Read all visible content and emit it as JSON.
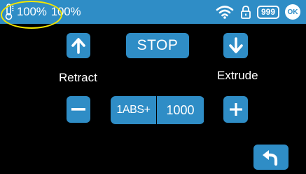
{
  "status_bar": {
    "nozzle_icon": "thermometer-icon",
    "temp_value": "100%",
    "second_value": "100%",
    "icons": [
      "wifi-icon",
      "lock-icon"
    ],
    "count_badge": "999",
    "ok_badge": "OK",
    "highlight_color": "#f2e600"
  },
  "controls": {
    "stop_label": "STOP",
    "retract_label": "Retract",
    "extrude_label": "Extrude",
    "mode_label": "1ABS+",
    "amount_label": "1000"
  },
  "icons": {
    "retract": "arrow-up-icon",
    "extrude": "arrow-down-icon",
    "decrease": "minus-icon",
    "increase": "plus-icon",
    "back": "back-arrow-icon"
  },
  "colors": {
    "accent": "#2f8dc6",
    "background": "#000000",
    "text": "#ffffff"
  }
}
